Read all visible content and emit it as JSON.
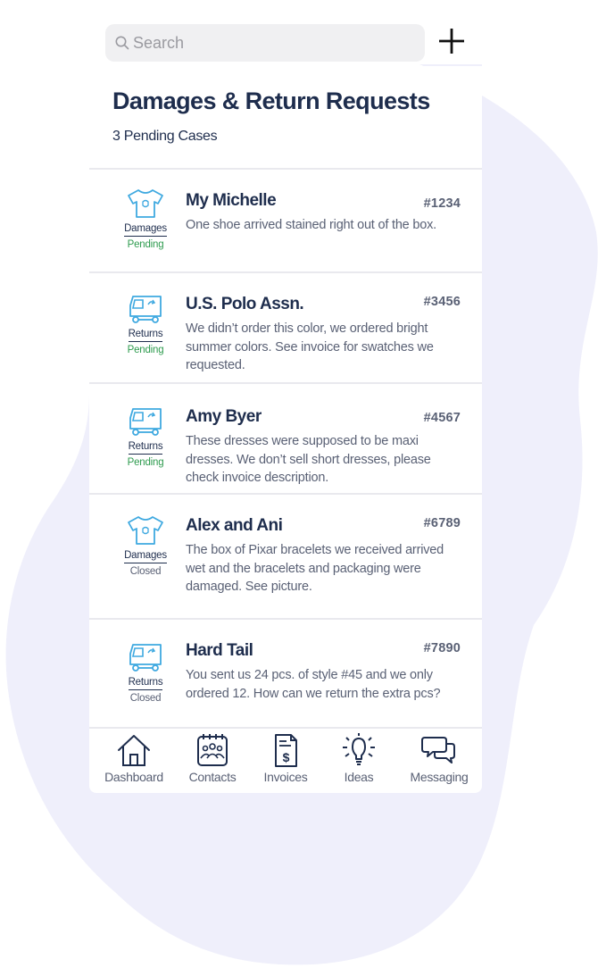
{
  "search": {
    "placeholder": "Search",
    "search_icon": "search-icon"
  },
  "toolbar": {
    "add_icon": "plus-icon"
  },
  "header": {
    "title": "Damages & Return Requests",
    "subtitle": "3 Pending Cases"
  },
  "colors": {
    "navy": "#1e2d4d",
    "accent_blue": "#3fa9e0",
    "pending_green": "#2e9b4f",
    "muted_text": "#5a6175",
    "blob": "#efeffb"
  },
  "cases": [
    {
      "icon": "shirt-icon",
      "type": "Damages",
      "status": "Pending",
      "name": "My Michelle",
      "number": "#1234",
      "description": "One shoe arrived stained right out of the box."
    },
    {
      "icon": "truck-icon",
      "type": "Returns",
      "status": "Pending",
      "name": "U.S. Polo Assn.",
      "number": "#3456",
      "description": "We didn’t order this color, we ordered bright summer colors.  See invoice for swatches we requested."
    },
    {
      "icon": "truck-icon",
      "type": "Returns",
      "status": "Pending",
      "name": "Amy Byer",
      "number": "#4567",
      "description": "These dresses were supposed to be maxi dresses.  We don’t sell short dresses, please check invoice description."
    },
    {
      "icon": "shirt-icon",
      "type": "Damages",
      "status": "Closed",
      "name": "Alex and Ani",
      "number": "#6789",
      "description": "The box of Pixar bracelets we received arrived wet and the bracelets and packaging were damaged.  See picture."
    },
    {
      "icon": "truck-icon",
      "type": "Returns",
      "status": "Closed",
      "name": "Hard Tail",
      "number": "#7890",
      "description": "You sent us 24 pcs. of style #45 and we only ordered 12.  How can we return the extra pcs?"
    }
  ],
  "tabbar": {
    "items": [
      {
        "label": "Dashboard",
        "icon": "home-icon"
      },
      {
        "label": "Contacts",
        "icon": "contacts-icon"
      },
      {
        "label": "Invoices",
        "icon": "invoice-icon"
      },
      {
        "label": "Ideas",
        "icon": "lightbulb-icon"
      },
      {
        "label": "Messaging",
        "icon": "chat-icon"
      }
    ]
  }
}
